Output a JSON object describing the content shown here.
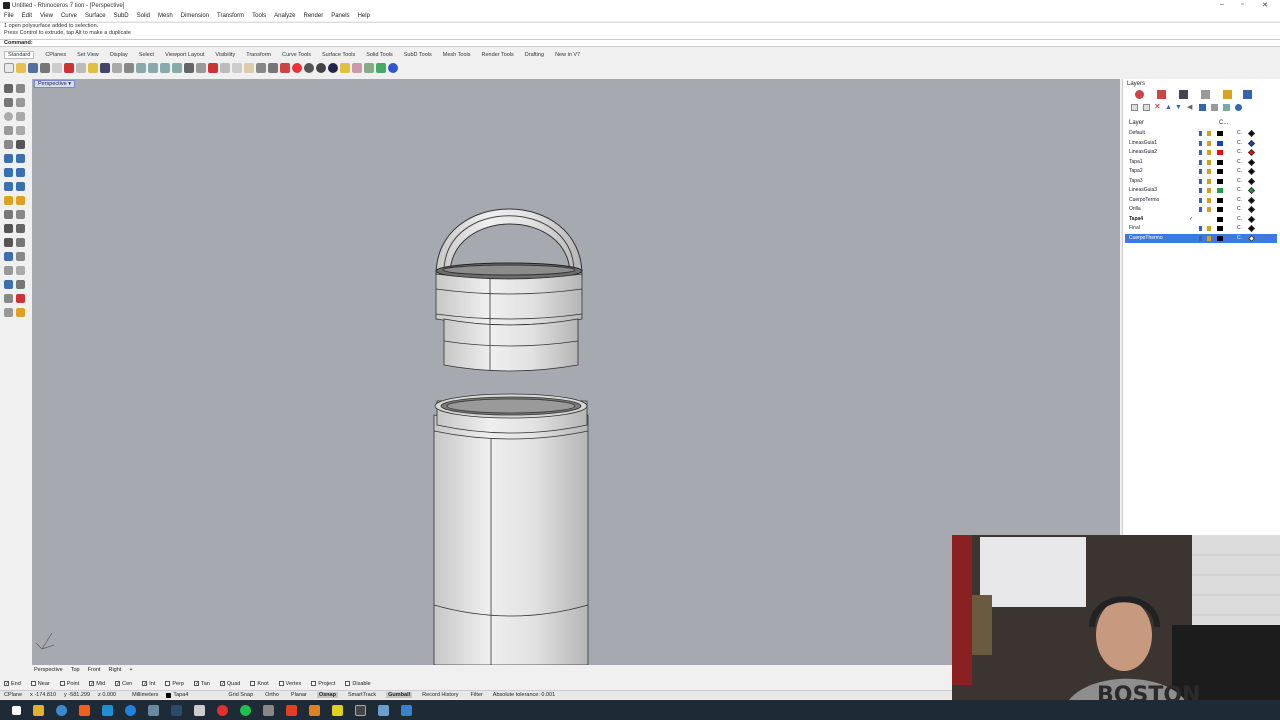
{
  "window": {
    "title": "Untitled - Rhinoceros 7 tion - [Perspective]"
  },
  "menu": [
    "File",
    "Edit",
    "View",
    "Curve",
    "Surface",
    "SubD",
    "Solid",
    "Mesh",
    "Dimension",
    "Transform",
    "Tools",
    "Analyze",
    "Render",
    "Panels",
    "Help"
  ],
  "command_history": [
    "1 open polysurface added to selection.",
    "Press Control to extrude, tap Alt to make a duplicate"
  ],
  "command_prompt": "Command:",
  "toolbar_tabs": [
    "Standard",
    "CPlanes",
    "Set View",
    "Display",
    "Select",
    "Viewport Layout",
    "Visibility",
    "Transform",
    "Curve Tools",
    "Surface Tools",
    "Solid Tools",
    "SubD Tools",
    "Mesh Tools",
    "Render Tools",
    "Drafting",
    "New in V7"
  ],
  "viewport": {
    "label": "Perspective",
    "dropdown_glyph": "▾"
  },
  "viewport_tabs": [
    "Perspective",
    "Top",
    "Front",
    "Right",
    "+"
  ],
  "layers_panel": {
    "title": "Layers",
    "col_layer": "Layer",
    "col_c": "C...",
    "rows": [
      {
        "name": "Default",
        "color": "#000000",
        "material": "#000000",
        "current": false,
        "selected": false
      },
      {
        "name": "LineasGuia1",
        "color": "#1040d0",
        "material": "#1040d0",
        "current": false,
        "selected": false
      },
      {
        "name": "LineasGuia2",
        "color": "#e01010",
        "material": "#e01010",
        "current": false,
        "selected": false
      },
      {
        "name": "Tapa1",
        "color": "#000000",
        "material": "#000000",
        "current": false,
        "selected": false
      },
      {
        "name": "Tapa2",
        "color": "#000000",
        "material": "#000000",
        "current": false,
        "selected": false
      },
      {
        "name": "Tapa3",
        "color": "#000000",
        "material": "#000000",
        "current": false,
        "selected": false
      },
      {
        "name": "LineasGuia3",
        "color": "#20a040",
        "material": "#20a040",
        "current": false,
        "selected": false
      },
      {
        "name": "CuerpoTermo",
        "color": "#000000",
        "material": "#000000",
        "current": false,
        "selected": false
      },
      {
        "name": "Orilla",
        "color": "#000000",
        "material": "#000000",
        "current": false,
        "selected": false
      },
      {
        "name": "Tapa4",
        "color": "#000000",
        "material": "#000000",
        "current": true,
        "selected": false
      },
      {
        "name": "Final",
        "color": "#000000",
        "material": "#000000",
        "current": false,
        "selected": false
      },
      {
        "name": "CuerpoThermo",
        "color": "#000000",
        "material": "#ffffff",
        "current": false,
        "selected": true
      }
    ]
  },
  "osnaps": [
    {
      "label": "End",
      "on": true
    },
    {
      "label": "Near",
      "on": false
    },
    {
      "label": "Point",
      "on": false
    },
    {
      "label": "Mid",
      "on": true
    },
    {
      "label": "Cen",
      "on": true
    },
    {
      "label": "Int",
      "on": true
    },
    {
      "label": "Perp",
      "on": false
    },
    {
      "label": "Tan",
      "on": true
    },
    {
      "label": "Quad",
      "on": true
    },
    {
      "label": "Knot",
      "on": false
    },
    {
      "label": "Vertex",
      "on": false
    },
    {
      "label": "Project",
      "on": false
    },
    {
      "label": "Disable",
      "on": false
    }
  ],
  "status": {
    "cplane": "CPlane",
    "x": "x -174.810",
    "y": "y -581.299",
    "z": "z 0.000",
    "units": "Millimeters",
    "layer": "Tapa4",
    "toggles": [
      {
        "label": "Grid Snap",
        "on": false
      },
      {
        "label": "Ortho",
        "on": false
      },
      {
        "label": "Planar",
        "on": false
      },
      {
        "label": "Osnap",
        "on": true
      },
      {
        "label": "SmartTrack",
        "on": false
      },
      {
        "label": "Gumball",
        "on": true
      },
      {
        "label": "Record History",
        "on": false
      },
      {
        "label": "Filter",
        "on": false
      }
    ],
    "tolerance": "Absolute tolerance: 0.001"
  },
  "webcam": {
    "shirt_text": "BOSTON"
  },
  "colors": {
    "viewport_bg": "#a6aab0",
    "selection": "#3d7ae0"
  }
}
